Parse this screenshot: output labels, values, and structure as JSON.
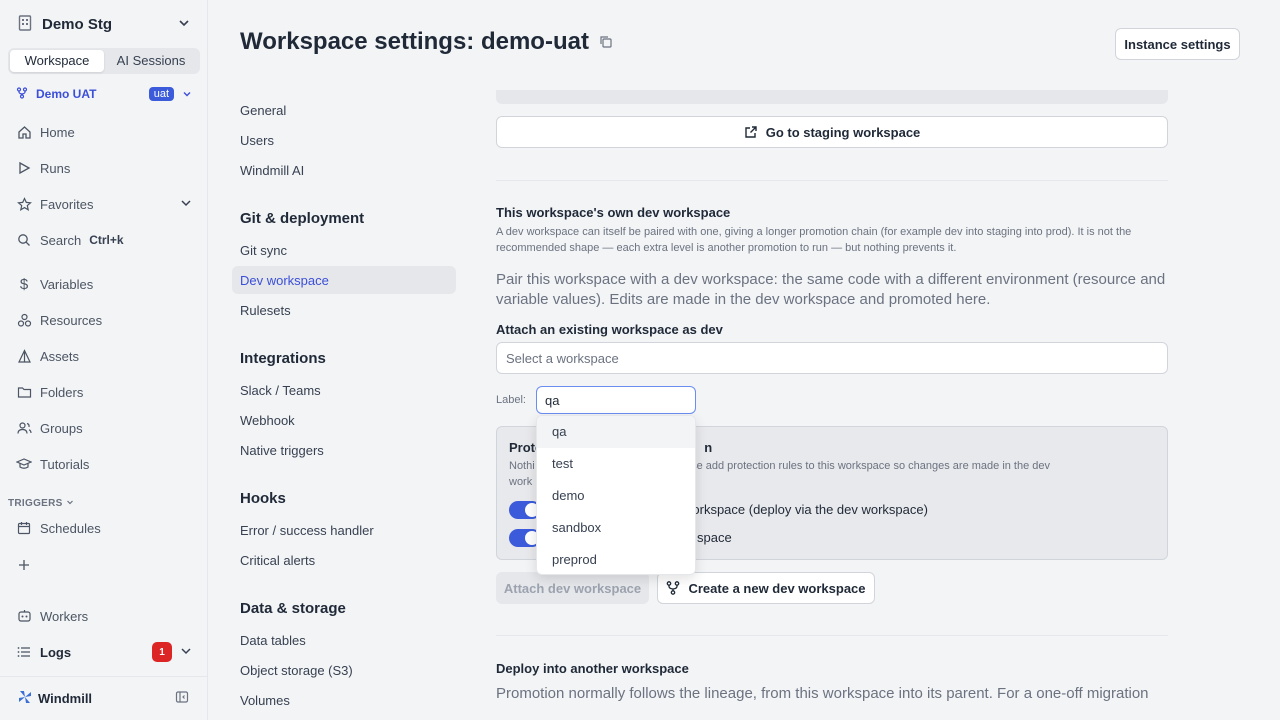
{
  "sidebar": {
    "workspace_name": "Demo Stg",
    "tabs": [
      "Workspace",
      "AI Sessions"
    ],
    "sub_workspace": {
      "label": "Demo UAT",
      "badge": "uat"
    },
    "items": {
      "home": "Home",
      "runs": "Runs",
      "favorites": "Favorites",
      "search": "Search",
      "search_kbd": "Ctrl+k",
      "variables": "Variables",
      "resources": "Resources",
      "assets": "Assets",
      "folders": "Folders",
      "groups": "Groups",
      "tutorials": "Tutorials",
      "triggers_header": "TRIGGERS",
      "schedules": "Schedules",
      "workers": "Workers",
      "logs": "Logs",
      "logs_count": "1"
    },
    "brand": "Windmill"
  },
  "header": {
    "title": "Workspace settings: demo-uat",
    "instance_settings": "Instance settings"
  },
  "subnav": {
    "general": "General",
    "users": "Users",
    "windmill_ai": "Windmill AI",
    "git_header": "Git & deployment",
    "git_sync": "Git sync",
    "dev_workspace": "Dev workspace",
    "rulesets": "Rulesets",
    "integrations_header": "Integrations",
    "slack": "Slack / Teams",
    "webhook": "Webhook",
    "native_triggers": "Native triggers",
    "hooks_header": "Hooks",
    "error_handler": "Error / success handler",
    "critical_alerts": "Critical alerts",
    "data_header": "Data & storage",
    "data_tables": "Data tables",
    "object_storage": "Object storage (S3)",
    "volumes": "Volumes"
  },
  "content": {
    "go_staging": "Go to staging workspace",
    "own_dev_title": "This workspace's own dev workspace",
    "own_dev_desc": "A dev workspace can itself be paired with one, giving a longer promotion chain (for example dev into staging into prod). It is not the recommended shape — each extra level is another promotion to run — but nothing prevents it.",
    "pair_desc": "Pair this workspace with a dev workspace: the same code with a different environment (resource and variable values). Edits are made in the dev workspace and promoted here.",
    "attach_title": "Attach an existing workspace as dev",
    "select_placeholder": "Select a workspace",
    "label_caption": "Label:",
    "label_value": "qa",
    "protect_title_start": "Prote",
    "protect_title_end": "n",
    "protect_desc_a": "Nothi",
    "protect_desc_b": ": these add protection rules to this workspace so changes are made in the dev",
    "protect_desc_c": "work",
    "toggle1_label": "workspace (deploy via the dev workspace)",
    "toggle2_label": "space",
    "attach_btn": "Attach dev workspace",
    "create_btn": "Create a new dev workspace",
    "deploy_title": "Deploy into another workspace",
    "deploy_desc": "Promotion normally follows the lineage, from this workspace into its parent. For a one-off migration"
  },
  "dropdown": {
    "options": [
      "qa",
      "test",
      "demo",
      "sandbox",
      "preprod"
    ],
    "highlighted": "qa"
  },
  "colors": {
    "accent": "#3b5bdb",
    "danger": "#dc2626"
  }
}
